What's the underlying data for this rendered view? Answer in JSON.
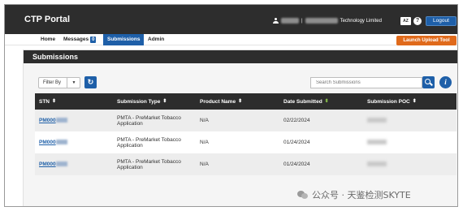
{
  "header": {
    "title": "CTP Portal",
    "company_suffix": "Technology Limited",
    "separator": "|",
    "az_label": "AZ",
    "help_label": "?",
    "logout_label": "Logout"
  },
  "nav": {
    "items": [
      "Home",
      "Messages",
      "Submissions",
      "Admin"
    ],
    "messages_count": "0",
    "active": "Submissions",
    "launch_label": "Launch Upload Tool"
  },
  "section": {
    "title": "Submissions"
  },
  "toolbar": {
    "filter_label": "Filter By",
    "filter_caret": "▼",
    "refresh_symbol": "↻",
    "search_placeholder": "Search Submissions",
    "info_symbol": "i"
  },
  "table": {
    "columns": [
      "STN",
      "Submission Type",
      "Product Name",
      "Date Submitted",
      "Submission POC"
    ],
    "rows": [
      {
        "stn": "PM000",
        "type": "PMTA - PreMarket Tobacco Application",
        "product": "N/A",
        "date": "02/22/2024"
      },
      {
        "stn": "PM000",
        "type": "PMTA - PreMarket Tobacco Application",
        "product": "N/A",
        "date": "01/24/2024"
      },
      {
        "stn": "PM000",
        "type": "PMTA - PreMarket Tobacco Application",
        "product": "N/A",
        "date": "01/24/2024"
      }
    ]
  },
  "watermark": {
    "text": "公众号 · 天鉴检测SKYTE"
  },
  "colors": {
    "dark_bar": "#2d2d2d",
    "primary_blue": "#1e5fa8",
    "launch_orange": "#e06a1b",
    "sort_active_green": "#8bc34a"
  }
}
